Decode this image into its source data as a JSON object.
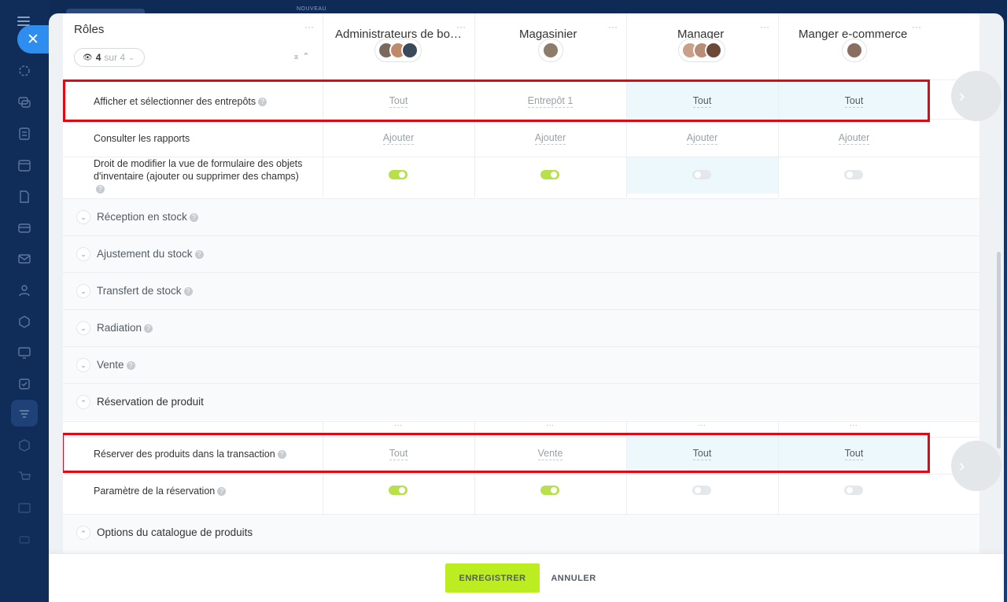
{
  "background": {
    "nouveau_label": "NOUVEAU"
  },
  "sidebar": {
    "close_glyph": "✕",
    "icons": [
      "menu-icon",
      "activity-icon",
      "chat-icon",
      "tasks-icon",
      "calendar-icon",
      "documents-icon",
      "inventory-icon",
      "mail-icon",
      "contacts-icon",
      "sites-icon",
      "analytics-icon",
      "checklist-icon",
      "filter-icon",
      "box-icon",
      "cart-icon",
      "store-icon",
      "history-icon"
    ]
  },
  "header": {
    "roles_title": "Rôles",
    "counter": {
      "shown": "4",
      "of_label": "sur 4"
    },
    "roles": [
      {
        "name": "Administrateurs de bo…",
        "avatars": [
          "#7a6a5e",
          "#c08a6a",
          "#3b4a5a"
        ]
      },
      {
        "name": "Magasinier",
        "avatars": [
          "#8d7b6b"
        ]
      },
      {
        "name": "Manager",
        "avatars": [
          "#c9a08a",
          "#b98c76",
          "#6b4a3a"
        ]
      },
      {
        "name": "Manger e-commerce",
        "avatars": [
          "#8a6f60"
        ]
      }
    ],
    "more_glyph": "···"
  },
  "rows": {
    "warehouses": {
      "label": "Afficher et sélectionner des entrepôts",
      "values": [
        "Tout",
        "Entrepôt 1",
        "Tout",
        "Tout"
      ]
    },
    "reports": {
      "label": "Consulter les rapports",
      "values": [
        "Ajouter",
        "Ajouter",
        "Ajouter",
        "Ajouter"
      ]
    },
    "form_view": {
      "label": "Droit de modifier la vue de formulaire des objets d'inventaire (ajouter ou supprimer des champs)",
      "toggles": [
        true,
        true,
        false,
        false
      ]
    },
    "reserve": {
      "label": "Réserver des produits dans la transaction",
      "values": [
        "Tout",
        "Vente",
        "Tout",
        "Tout"
      ]
    },
    "reserve_param": {
      "label": "Paramètre de la réservation",
      "toggles": [
        true,
        true,
        false,
        false
      ]
    }
  },
  "sections": {
    "reception": "Réception en stock",
    "adjustment": "Ajustement du stock",
    "transfer": "Transfert de stock",
    "writeoff": "Radiation",
    "sale": "Vente",
    "reservation": "Réservation de produit",
    "catalog": "Options du catalogue de produits"
  },
  "footer": {
    "save_label": "ENREGISTRER",
    "cancel_label": "ANNULER"
  },
  "colors": {
    "accent_red": "#e30613",
    "toggle_on": "#b8e04a",
    "save_button": "#bbed21",
    "highlight": "#ecf8fb",
    "close_button": "#2d8ef0"
  }
}
